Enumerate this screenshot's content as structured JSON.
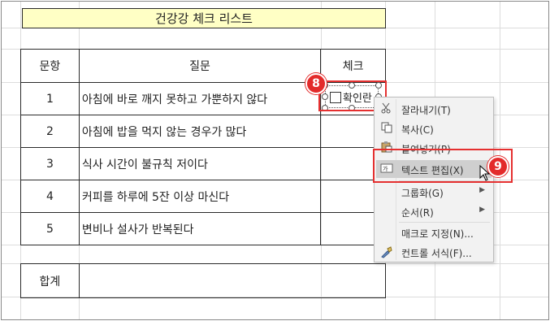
{
  "title": "건강강 체크 리스트",
  "table": {
    "headers": {
      "no": "문항",
      "question": "질문",
      "check": "체크"
    },
    "rows": [
      {
        "no": "1",
        "question": "아침에 바로 깨지 못하고 가뿐하지 않다"
      },
      {
        "no": "2",
        "question": "아침에 밥을 먹지 않는 경우가 많다"
      },
      {
        "no": "3",
        "question": "식사 시간이 불규칙 저이다"
      },
      {
        "no": "4",
        "question": "커피를 하루에 5잔 이상 마신다"
      },
      {
        "no": "5",
        "question": "변비나 설사가 반복된다"
      }
    ],
    "total_label": "합계"
  },
  "checkbox": {
    "label": "확인란"
  },
  "badges": {
    "step8": "8",
    "step9": "9"
  },
  "context_menu": {
    "items": [
      {
        "label": "잘라내기(T)",
        "icon": "scissors-icon"
      },
      {
        "label": "복사(C)",
        "icon": "copy-icon"
      },
      {
        "label": "붙여넣기(P)",
        "icon": "paste-icon"
      },
      {
        "label": "텍스트 편집(X)",
        "icon": "text-edit-icon"
      },
      {
        "label": "그룹화(G)",
        "icon": "none"
      },
      {
        "label": "순서(R)",
        "icon": "none"
      },
      {
        "label": "매크로 지정(N)...",
        "icon": "none"
      },
      {
        "label": "컨트롤 서식(F)...",
        "icon": "format-control-icon"
      }
    ]
  },
  "colors": {
    "title_fill": "#ffffc5",
    "highlight": "#e53030",
    "badge": "#e32b2b"
  }
}
